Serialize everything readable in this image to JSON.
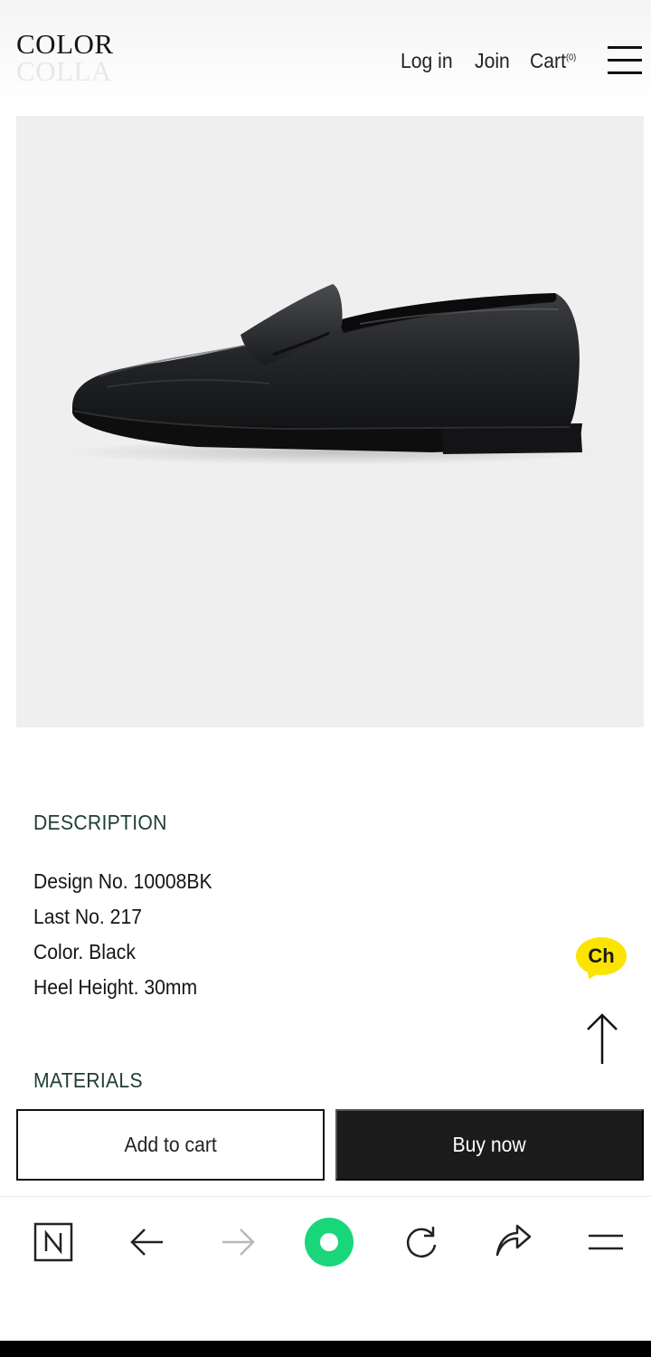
{
  "header": {
    "logo_line1": "COLOR",
    "logo_line2": "COLLA",
    "nav": {
      "login": "Log in",
      "join": "Join",
      "cart": "Cart",
      "cart_count": "(0)"
    }
  },
  "product": {
    "image_icon": "penny-loafer-shoe-image",
    "color": "Black"
  },
  "description": {
    "title": "DESCRIPTION",
    "items": [
      "Design No. 10008BK",
      "Last No. 217",
      "Color. Black",
      "Heel Height. 30mm"
    ]
  },
  "materials": {
    "title": "MATERIALS"
  },
  "floating": {
    "chat_label": "Ch",
    "chat_color": "#fbe400",
    "top_icon": "arrow-up-icon"
  },
  "actions": {
    "add_to_cart": "Add to cart",
    "buy_now": "Buy now",
    "buy_bg": "#1b1b1b"
  },
  "browser_toolbar": {
    "icons": [
      "naver-n-icon",
      "back-arrow-icon",
      "forward-arrow-icon",
      "home-circle-icon",
      "refresh-icon",
      "share-icon",
      "menu-icon"
    ],
    "accent": "#19d67b"
  }
}
